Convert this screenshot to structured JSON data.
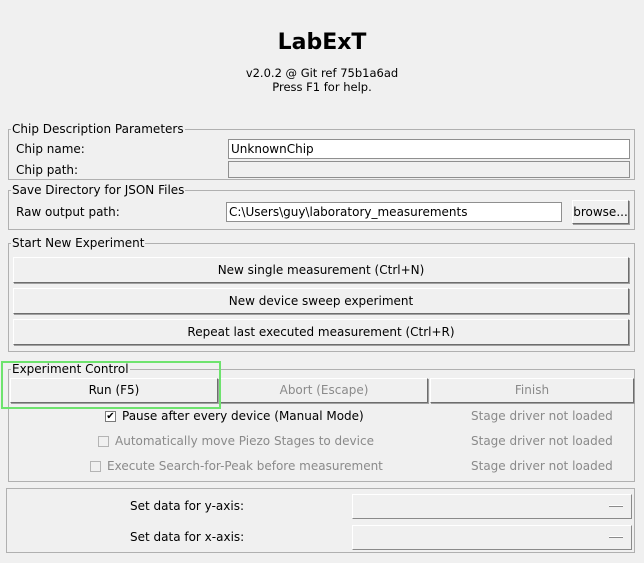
{
  "header": {
    "title": "LabExT",
    "version": "v2.0.2 @ Git ref 75b1a6ad",
    "help": "Press F1 for help."
  },
  "chip_description": {
    "legend": "Chip Description Parameters",
    "chip_name_label": "Chip name:",
    "chip_name_value": "UnknownChip",
    "chip_path_label": "Chip path:",
    "chip_path_value": ""
  },
  "save_directory": {
    "legend": "Save Directory for JSON Files",
    "raw_output_label": "Raw output path:",
    "raw_output_value": "C:\\Users\\guy\\laboratory_measurements",
    "browse_label": "browse..."
  },
  "start_experiment": {
    "legend": "Start New Experiment",
    "single_measurement": "New single measurement (Ctrl+N)",
    "device_sweep": "New device sweep experiment",
    "repeat_last": "Repeat last executed measurement (Ctrl+R)"
  },
  "experiment_control": {
    "legend": "Experiment Control",
    "run": "Run (F5)",
    "abort": "Abort (Escape)",
    "finish": "Finish",
    "options": [
      {
        "label": "Pause after every device (Manual Mode)",
        "checked": true,
        "enabled": true,
        "status": "Stage driver not loaded"
      },
      {
        "label": "Automatically move Piezo Stages to device",
        "checked": false,
        "enabled": false,
        "status": "Stage driver not loaded"
      },
      {
        "label": "Execute Search-for-Peak before measurement",
        "checked": false,
        "enabled": false,
        "status": "Stage driver not loaded"
      }
    ]
  },
  "axis_selection": {
    "y_label": "Set data for y-axis:",
    "x_label": "Set data for x-axis:",
    "y_value": "",
    "x_value": ""
  },
  "colors": {
    "background": "#f0f0f0",
    "highlight": "#6ee36e",
    "disabled_text": "#8a8a8a"
  }
}
